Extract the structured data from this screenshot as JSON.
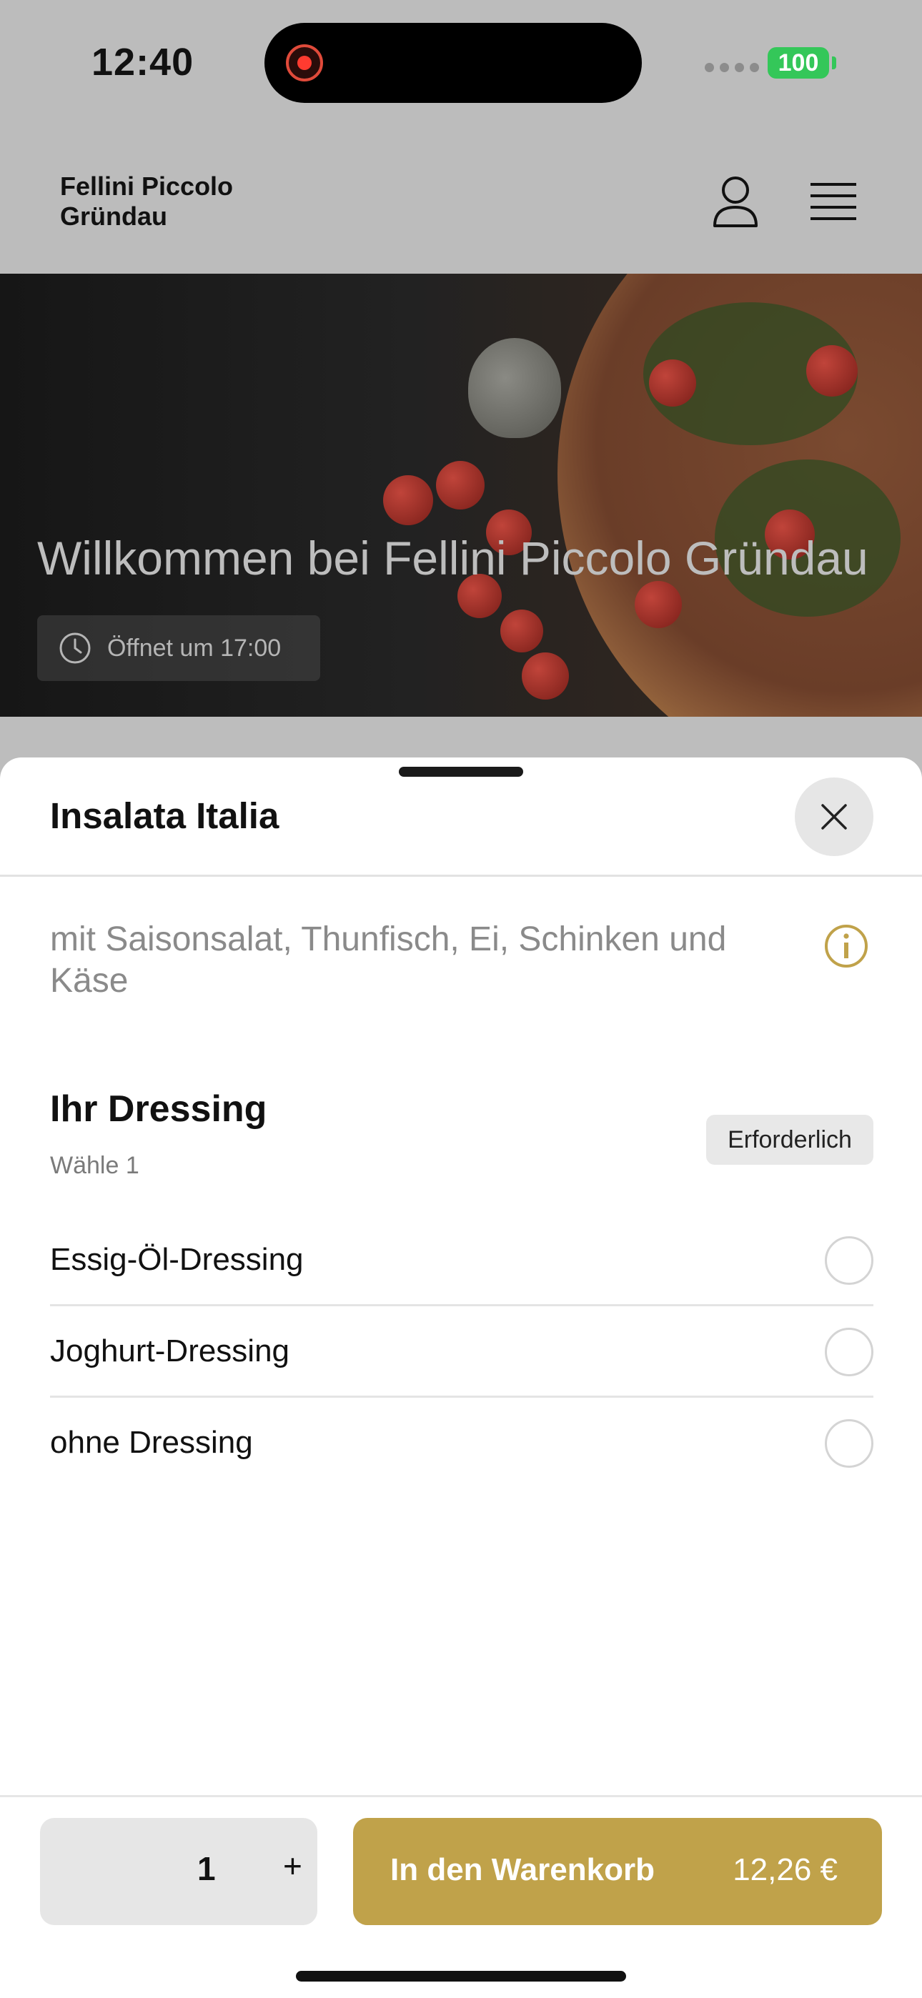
{
  "status_bar": {
    "time": "12:40",
    "battery": "100",
    "battery_color": "#34c759",
    "recording_color": "#ff3b30"
  },
  "header": {
    "brand_line1": "Fellini Piccolo",
    "brand_line2": "Gründau",
    "user_icon": "user-icon",
    "menu_icon": "hamburger-menu-icon"
  },
  "hero": {
    "title": "Willkommen bei Fellini Piccolo Gründau",
    "hours_icon": "clock-icon",
    "hours": "Öffnet um 17:00"
  },
  "sheet": {
    "title": "Insalata Italia",
    "close_icon": "close-icon",
    "description": "mit Saisonsalat, Thunfisch, Ei, Schinken und Käse",
    "info_icon": "info-icon",
    "accent_color": "#c0a24a"
  },
  "dressing": {
    "title": "Ihr Dressing",
    "subtitle": "Wähle 1",
    "required": "Erforderlich",
    "options": [
      {
        "label": "Essig-Öl-Dressing",
        "selected": false
      },
      {
        "label": "Joghurt-Dressing",
        "selected": false
      },
      {
        "label": "ohne Dressing",
        "selected": false
      }
    ]
  },
  "footer": {
    "quantity": "1",
    "plus": "+",
    "cart_label": "In den Warenkorb",
    "price": "12,26 €"
  }
}
